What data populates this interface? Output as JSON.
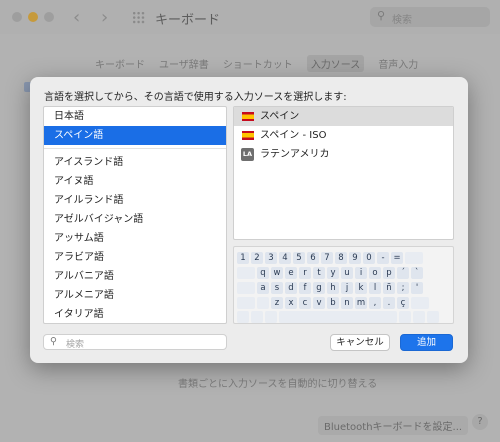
{
  "background_window": {
    "title": "キーボード",
    "search_placeholder": "検索",
    "tabs": [
      "キーボード",
      "ユーザ辞書",
      "ショートカット",
      "入力ソース",
      "音声入力"
    ],
    "active_tab": "入力ソース",
    "bottom_text": "書類ごとに入力ソースを自動的に切り替える",
    "bluetooth_button": "Bluetoothキーボードを設定...",
    "help": "?"
  },
  "sheet": {
    "instruction": "言語を選択してから、その言語で使用する入力ソースを選択します:",
    "languages_top": [
      "日本語",
      "スペイン語"
    ],
    "selected_language": "スペイン語",
    "languages": [
      "アイスランド語",
      "アイヌ語",
      "アイルランド語",
      "アゼルバイジャン語",
      "アッサム語",
      "アラビア語",
      "アルバニア語",
      "アルメニア語",
      "イタリア語"
    ],
    "input_sources": [
      {
        "label": "スペイン",
        "icon": "spain-flag-icon",
        "selected": true
      },
      {
        "label": "スペイン - ISO",
        "icon": "spain-flag-icon",
        "selected": false
      },
      {
        "label": "ラテンアメリカ",
        "icon": "la-badge-icon",
        "badge": "LA",
        "selected": false
      }
    ],
    "keyboard_rows": [
      [
        "1",
        "2",
        "3",
        "4",
        "5",
        "6",
        "7",
        "8",
        "9",
        "0",
        "-",
        "="
      ],
      [
        "q",
        "w",
        "e",
        "r",
        "t",
        "y",
        "u",
        "i",
        "o",
        "p",
        "´",
        "`"
      ],
      [
        "a",
        "s",
        "d",
        "f",
        "g",
        "h",
        "j",
        "k",
        "l",
        "ñ",
        ";",
        "'"
      ],
      [
        "z",
        "x",
        "c",
        "v",
        "b",
        "n",
        "m",
        ",",
        ".",
        "ç"
      ]
    ],
    "search_placeholder": "検索",
    "cancel_label": "キャンセル",
    "add_label": "追加"
  },
  "colors": {
    "accent": "#1d74eb",
    "selected_row": "#1a6ee6"
  }
}
